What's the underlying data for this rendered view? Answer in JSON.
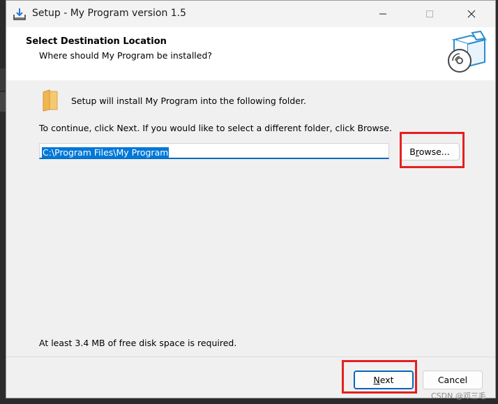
{
  "window": {
    "title": "Setup - My Program version 1.5",
    "icons": {
      "app": "setup-download-icon",
      "minimize": "minimize-icon",
      "maximize": "maximize-icon",
      "close": "close-icon"
    }
  },
  "header": {
    "title": "Select Destination Location",
    "subtitle": "Where should My Program be installed?",
    "image": "software-box-cd-icon"
  },
  "content": {
    "intro": "Setup will install My Program into the following folder.",
    "instruction": "To continue, click Next. If you would like to select a different folder, click Browse.",
    "path_value": "C:\\Program Files\\My Program",
    "disk_space": "At least 3.4 MB of free disk space is required.",
    "folder_icon": "folder-icon"
  },
  "buttons": {
    "browse_pre": "B",
    "browse_u": "r",
    "browse_post": "owse...",
    "next_u": "N",
    "next_post": "ext",
    "cancel": "Cancel"
  },
  "colors": {
    "accent": "#0067c0",
    "selection": "#0078d7",
    "annotation": "#e52020"
  },
  "watermark": "CSDN @邓三毛"
}
